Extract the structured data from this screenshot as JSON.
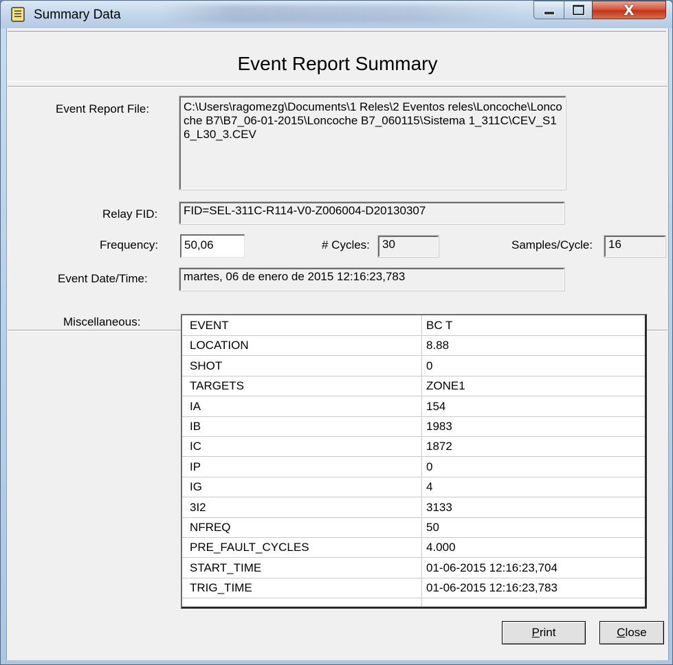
{
  "window": {
    "title": "Summary Data",
    "icon": "document-list-icon",
    "minimize_icon": "minimize-icon",
    "maximize_icon": "maximize-icon",
    "close_icon": "close-icon",
    "close_glyph": "X"
  },
  "report": {
    "title": "Event Report Summary"
  },
  "fields": {
    "event_report_file_label": "Event Report File:",
    "event_report_file_value": "C:\\Users\\ragomezg\\Documents\\1 Reles\\2 Eventos reles\\Loncoche\\Loncoche B7\\B7_06-01-2015\\Loncoche B7_060115\\Sistema 1_311C\\CEV_S16_L30_3.CEV",
    "relay_fid_label": "Relay FID:",
    "relay_fid_value": "FID=SEL-311C-R114-V0-Z006004-D20130307",
    "frequency_label": "Frequency:",
    "frequency_value": "50,06",
    "cycles_label": "# Cycles:",
    "cycles_value": "30",
    "samples_label": "Samples/Cycle:",
    "samples_value": "16",
    "event_datetime_label": "Event Date/Time:",
    "event_datetime_value": "martes, 06 de enero de 2015  12:16:23,783",
    "misc_label": "Miscellaneous:"
  },
  "misc_rows": [
    {
      "key": "EVENT",
      "value": "BC T"
    },
    {
      "key": "LOCATION",
      "value": "8.88"
    },
    {
      "key": "SHOT",
      "value": "0"
    },
    {
      "key": "TARGETS",
      "value": "ZONE1"
    },
    {
      "key": "IA",
      "value": "154"
    },
    {
      "key": "IB",
      "value": "1983"
    },
    {
      "key": "IC",
      "value": "1872"
    },
    {
      "key": "IP",
      "value": "0"
    },
    {
      "key": "IG",
      "value": "4"
    },
    {
      "key": "3I2",
      "value": "3133"
    },
    {
      "key": "NFREQ",
      "value": "50"
    },
    {
      "key": "PRE_FAULT_CYCLES",
      "value": "4.000"
    },
    {
      "key": "START_TIME",
      "value": "01-06-2015 12:16:23,704"
    },
    {
      "key": "TRIG_TIME",
      "value": "01-06-2015 12:16:23,783"
    }
  ],
  "buttons": {
    "print_mnemonic": "P",
    "print_rest": "rint",
    "close_mnemonic": "C",
    "close_rest": "lose"
  }
}
